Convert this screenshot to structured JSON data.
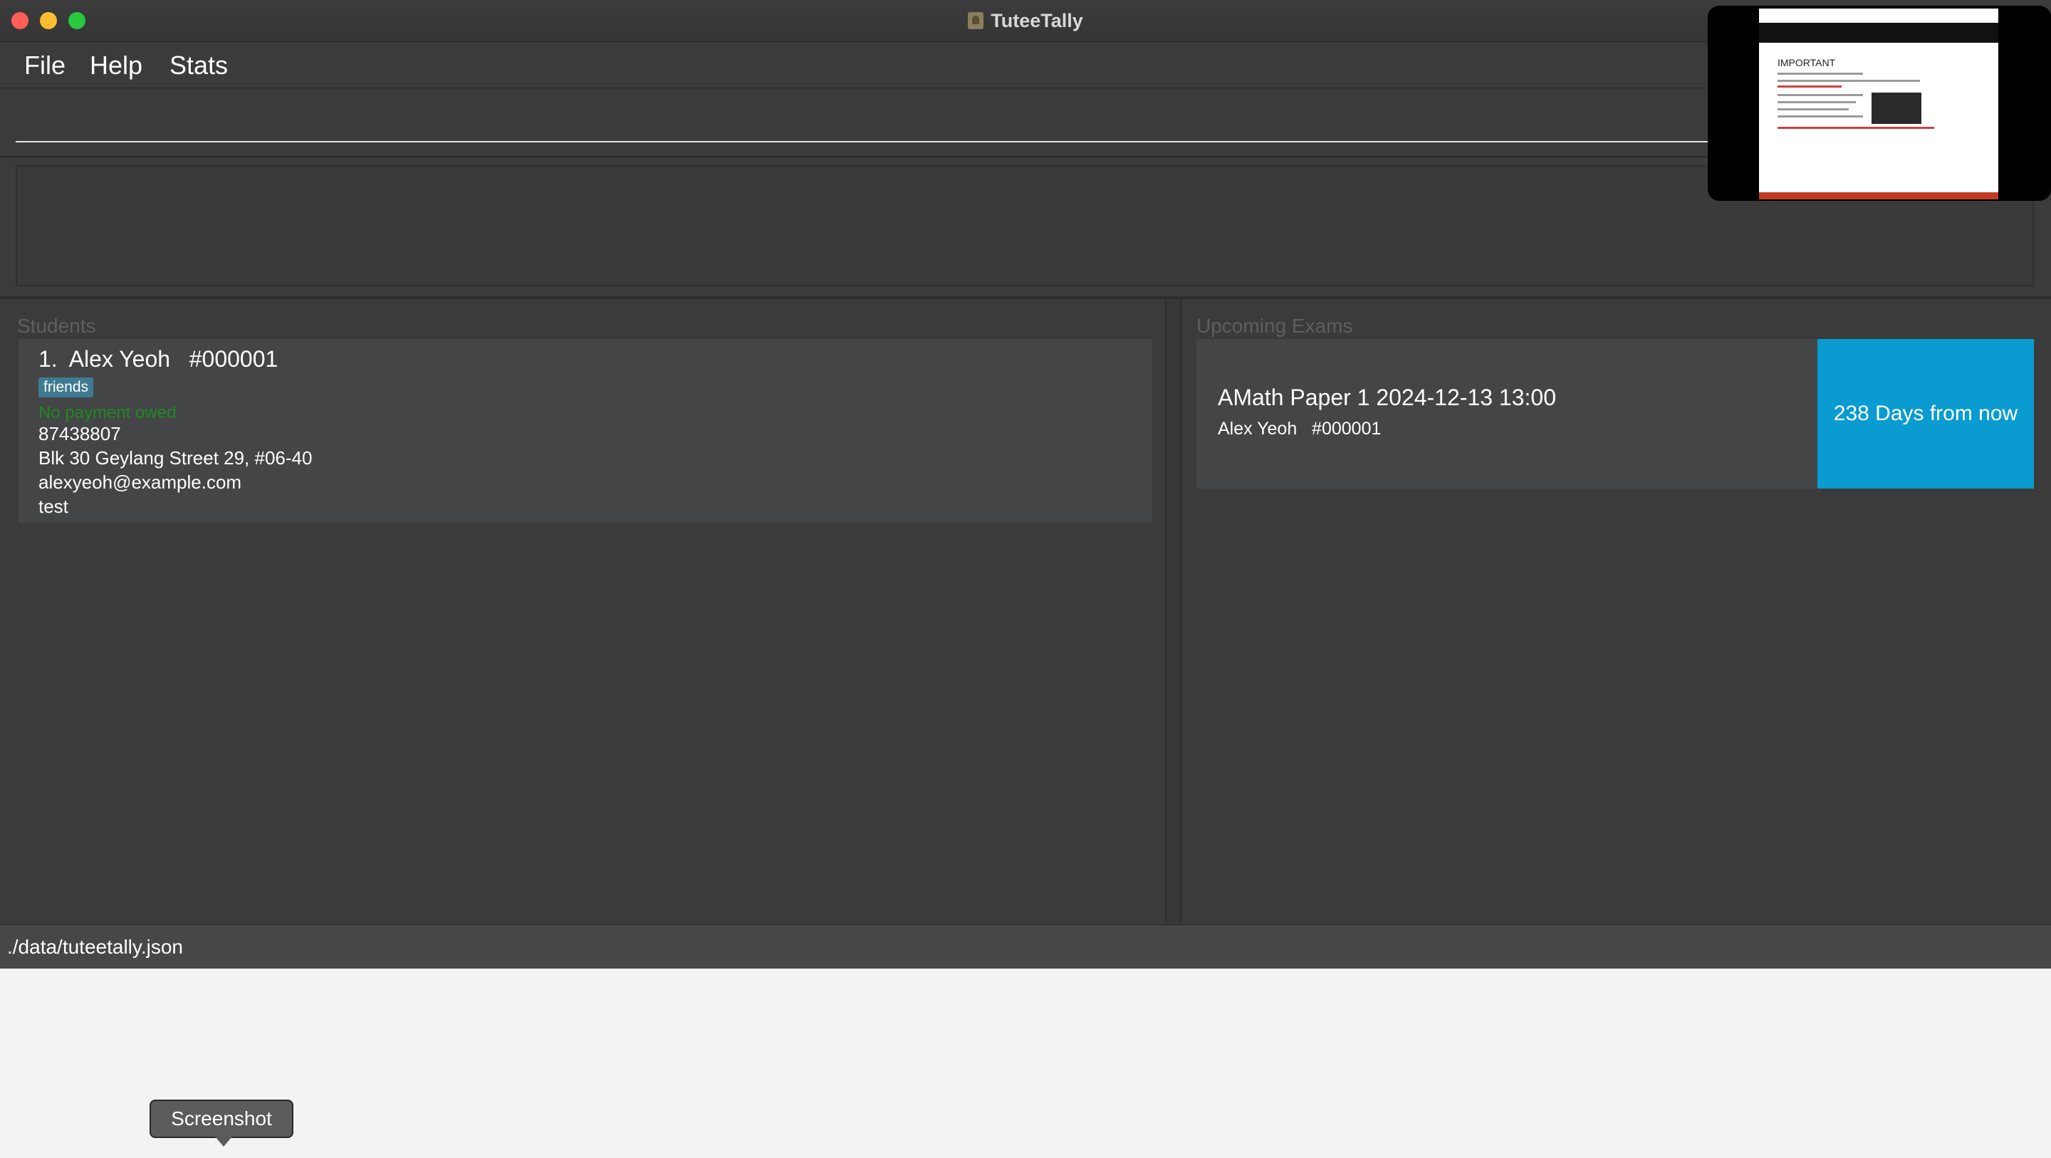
{
  "window": {
    "title": "TuteeTally"
  },
  "menu": {
    "items": [
      "File",
      "Help",
      "Stats"
    ]
  },
  "command": {
    "value": ""
  },
  "result": {
    "text": ""
  },
  "students": {
    "header": "Students",
    "list": [
      {
        "name_line": "1.  Alex Yeoh   #000001",
        "tag": "friends",
        "payment": "No payment owed",
        "phone": "87438807",
        "address": "Blk 30 Geylang Street 29, #06-40",
        "email": "alexyeoh@example.com",
        "remark": "test"
      }
    ]
  },
  "exams": {
    "header": "Upcoming Exams",
    "list": [
      {
        "title": "AMath Paper 1 2024-12-13 13:00",
        "student": "Alex Yeoh   #000001",
        "countdown": "238 Days from now"
      }
    ]
  },
  "status": {
    "path": "./data/tuteetally.json"
  },
  "tooltip": {
    "label": "Screenshot"
  },
  "colors": {
    "background": "#3b3b3b",
    "card": "#444547",
    "tag": "#3e7b91",
    "payment_ok": "#1f8a1f",
    "countdown": "#0a9bd0"
  }
}
